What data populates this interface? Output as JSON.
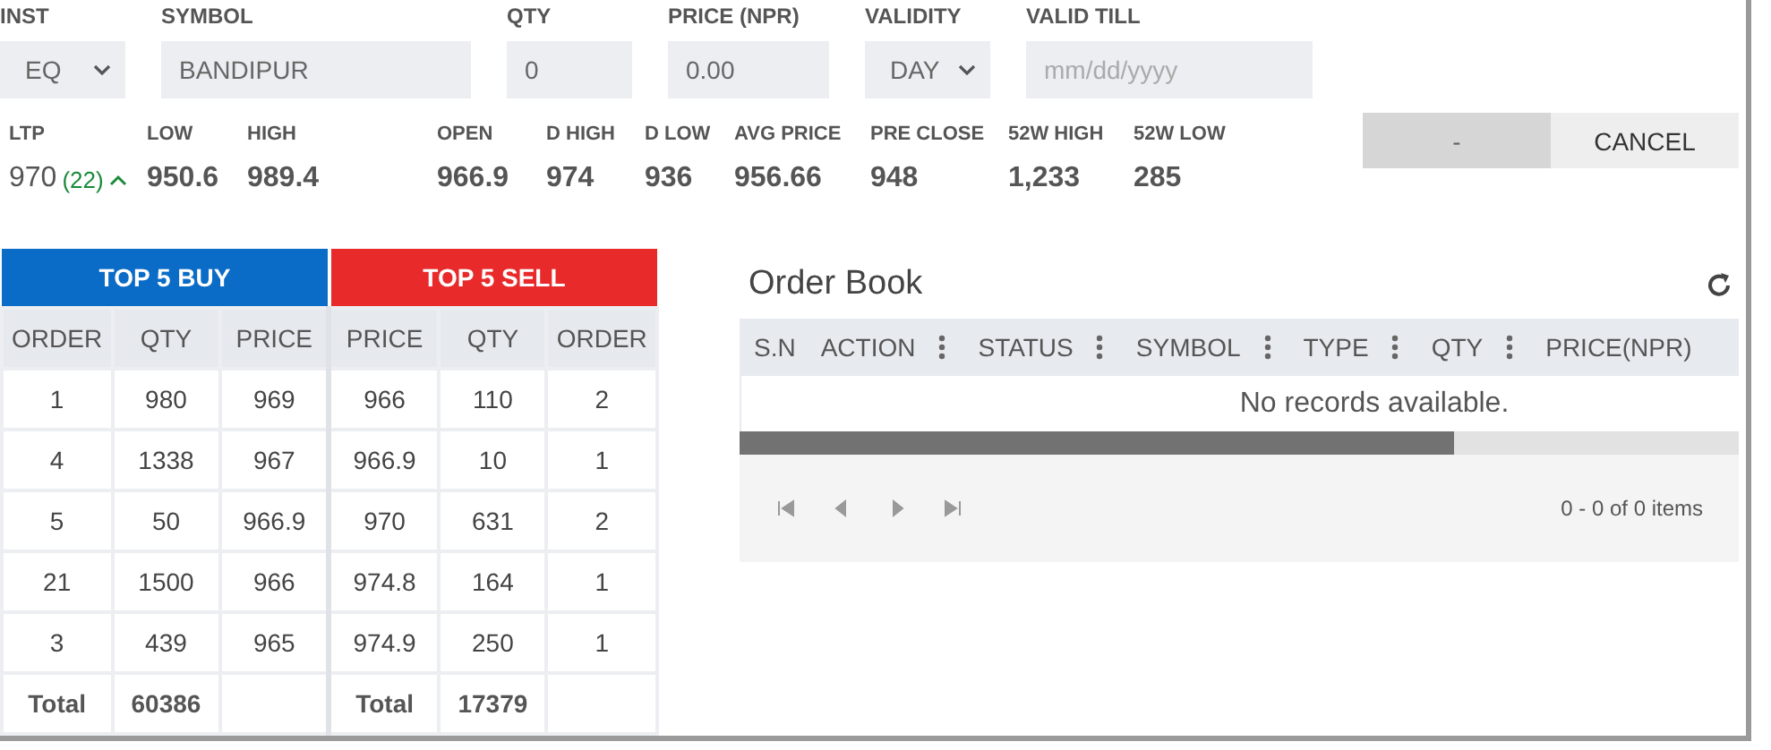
{
  "order_form": {
    "fields": [
      {
        "kind": "select",
        "label": "INST",
        "value": "EQ"
      },
      {
        "kind": "input",
        "label": "SYMBOL",
        "value": "BANDIPUR"
      },
      {
        "kind": "input",
        "label": "QTY",
        "value": "0"
      },
      {
        "kind": "input",
        "label": "PRICE (NPR)",
        "value": "0.00"
      },
      {
        "kind": "select",
        "label": "VALIDITY",
        "value": "DAY"
      },
      {
        "kind": "date",
        "label": "VALID TILL",
        "placeholder": "mm/dd/yyyy"
      }
    ]
  },
  "ltp": {
    "label": "LTP",
    "value": "970",
    "change": "(22)",
    "rising": true
  },
  "stats": [
    {
      "label": "LOW",
      "value": "950.6"
    },
    {
      "label": "HIGH",
      "value": "989.4"
    },
    {
      "label": "OPEN",
      "value": "966.9"
    },
    {
      "label": "D HIGH",
      "value": "974"
    },
    {
      "label": "D LOW",
      "value": "936"
    },
    {
      "label": "AVG PRICE",
      "value": "956.66"
    },
    {
      "label": "PRE CLOSE",
      "value": "948"
    },
    {
      "label": "52W HIGH",
      "value": "1,233"
    },
    {
      "label": "52W LOW",
      "value": "285"
    }
  ],
  "buttons": [
    {
      "label": "-",
      "kind": "action"
    },
    {
      "label": "CANCEL",
      "kind": "cancel"
    }
  ],
  "market_depth": {
    "buy_title": "TOP 5 BUY",
    "sell_title": "TOP 5 SELL",
    "columns": [
      "ORDER",
      "QTY",
      "PRICE",
      "PRICE",
      "QTY",
      "ORDER"
    ],
    "rows": [
      [
        "1",
        "980",
        "969",
        "966",
        "110",
        "2"
      ],
      [
        "4",
        "1338",
        "967",
        "966.9",
        "10",
        "1"
      ],
      [
        "5",
        "50",
        "966.9",
        "970",
        "631",
        "2"
      ],
      [
        "21",
        "1500",
        "966",
        "974.8",
        "164",
        "1"
      ],
      [
        "3",
        "439",
        "965",
        "974.9",
        "250",
        "1"
      ]
    ],
    "buy_total": {
      "label": "Total",
      "qty": "60386"
    },
    "sell_total": {
      "label": "Total",
      "qty": "17379"
    }
  },
  "order_book": {
    "title": "Order Book",
    "columns": [
      "S.N",
      "ACTION",
      "STATUS",
      "SYMBOL",
      "TYPE",
      "QTY",
      "PRICE(NPR)"
    ],
    "empty_message": "No records available.",
    "pager_info": "0 - 0 of 0 items"
  }
}
